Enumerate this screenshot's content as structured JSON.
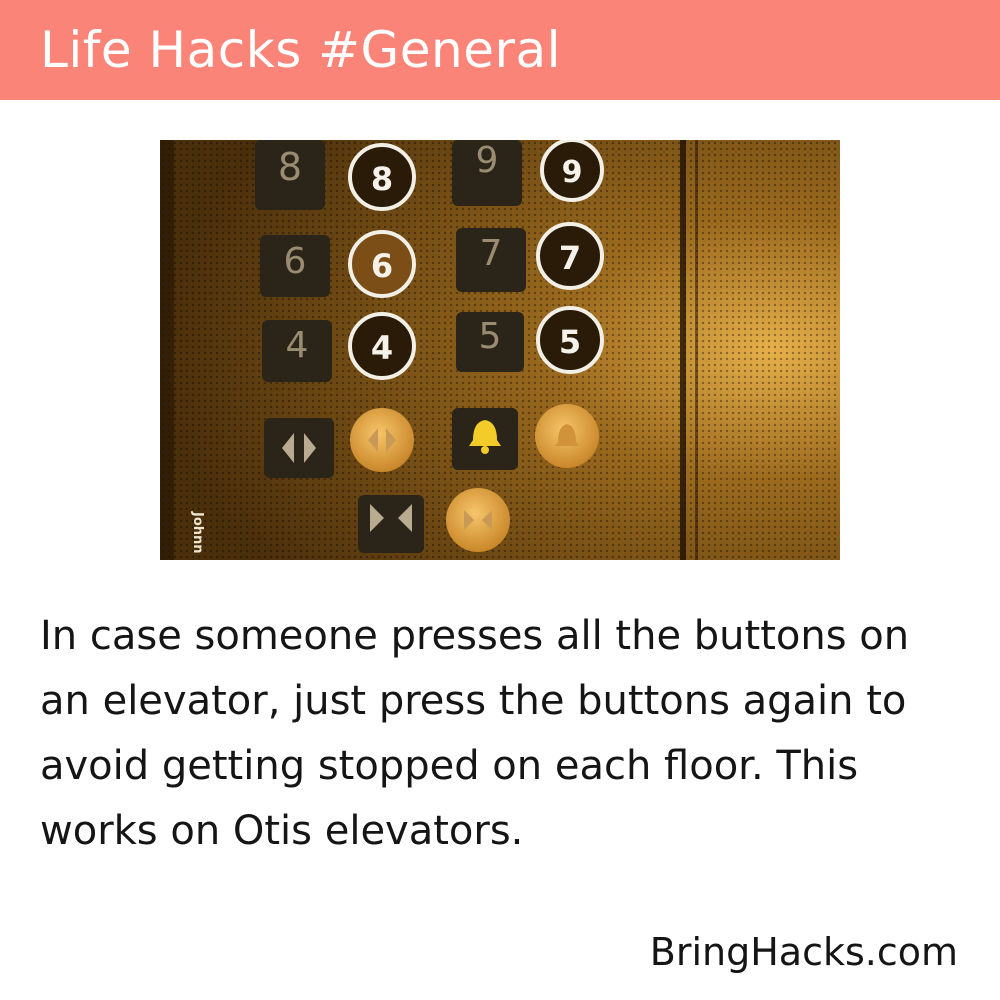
{
  "header": {
    "title": "Life Hacks #General",
    "background_color": "#fa8478"
  },
  "photo": {
    "subject": "elevator button panel",
    "buttons": [
      {
        "label": "8",
        "ring_label": "8"
      },
      {
        "label": "9",
        "ring_label": "9"
      },
      {
        "label": "6",
        "ring_label": "6"
      },
      {
        "label": "7",
        "ring_label": "7"
      },
      {
        "label": "4",
        "ring_label": "4"
      },
      {
        "label": "5",
        "ring_label": "5"
      }
    ],
    "icons": [
      "door-open-icon",
      "bell-icon",
      "door-close-icon"
    ],
    "credit_text": "Johnn"
  },
  "body": {
    "text": "In case someone presses all the buttons on an elevator, just press the buttons again to avoid getting stopped on each floor. This works on Otis elevators."
  },
  "footer": {
    "brand": "BringHacks.com"
  }
}
